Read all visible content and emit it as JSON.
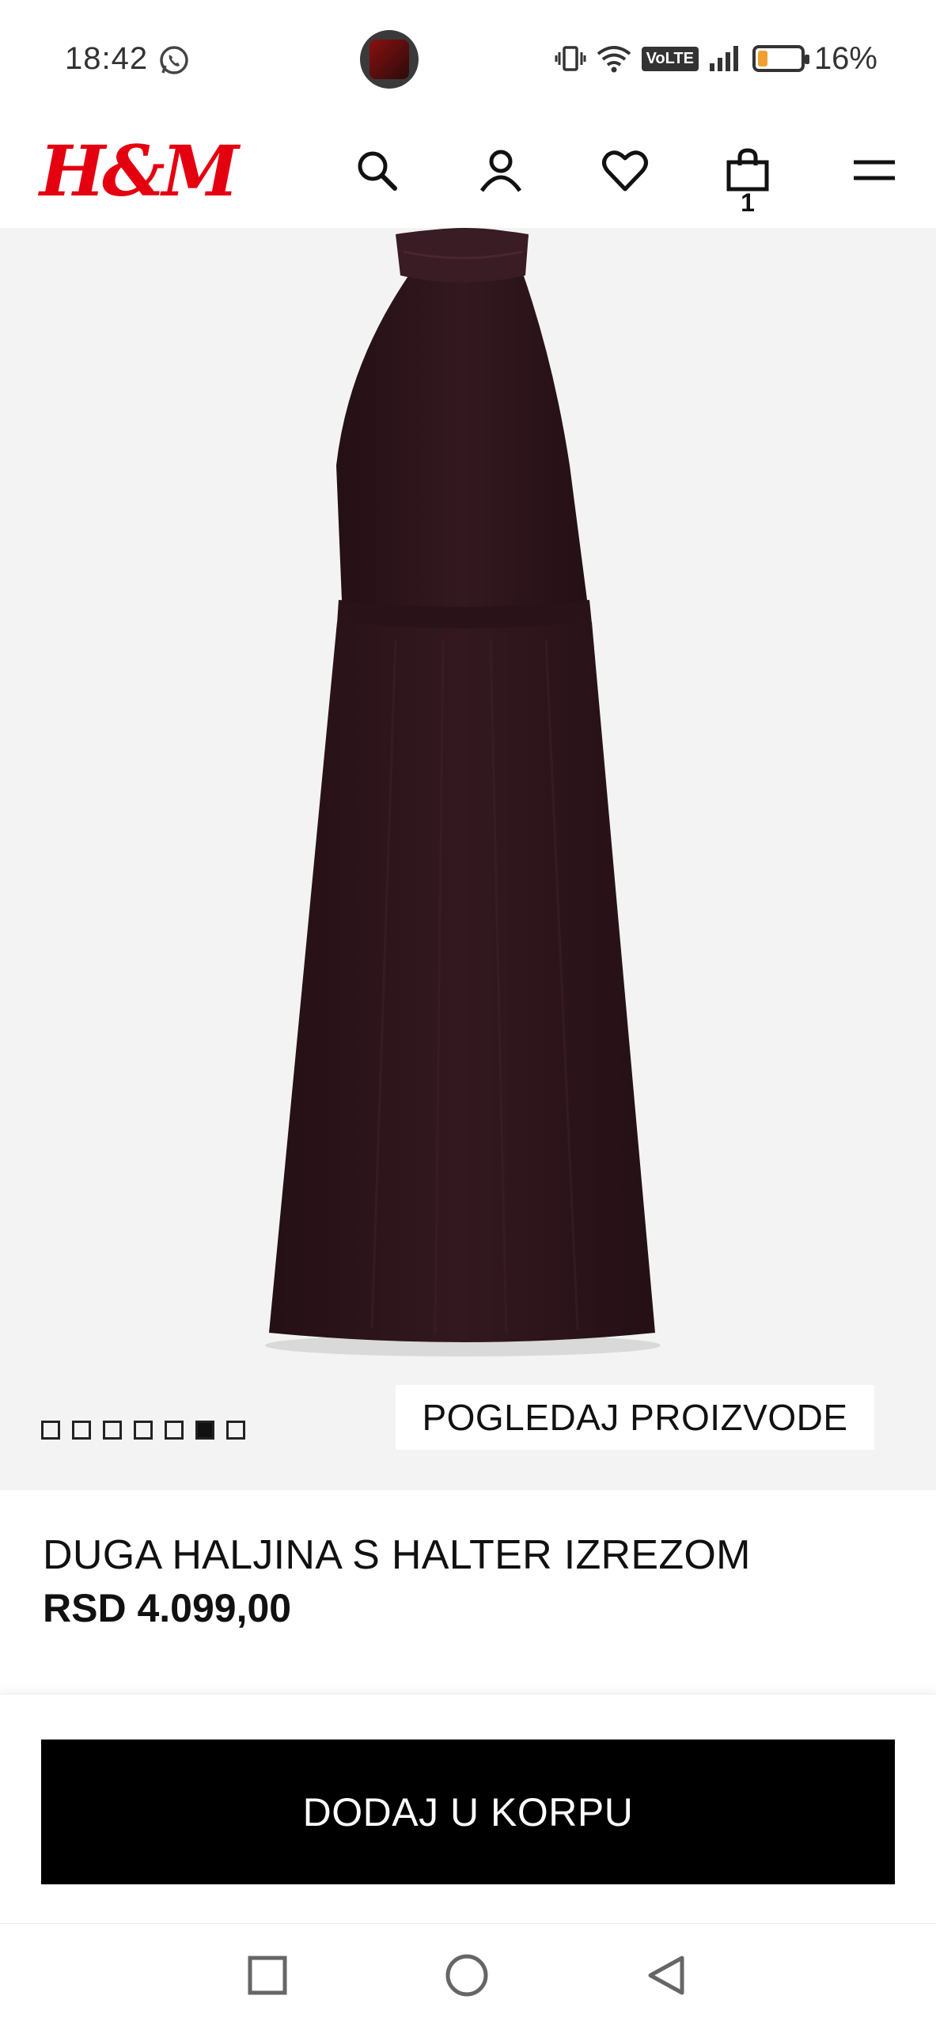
{
  "status_bar": {
    "time": "18:42",
    "battery_percent_text": "16%",
    "volte_label": "VoLTE",
    "icons": [
      "whatsapp-icon",
      "vibrate-icon",
      "wifi-icon",
      "volte-icon",
      "signal-icon",
      "battery-icon"
    ],
    "battery_level": 0.16
  },
  "header": {
    "logo_text": "H&M",
    "bag_count": "1",
    "icons": [
      "search-icon",
      "account-icon",
      "heart-icon",
      "bag-icon",
      "menu-icon"
    ],
    "brand_color": "#e50010"
  },
  "gallery": {
    "image_count": 7,
    "active_index": 5,
    "view_products_label": "POGLEDAJ PROIZVODE",
    "dress_color": "#2c151b"
  },
  "product": {
    "name": "DUGA HALJINA S HALTER IZREZOM",
    "price": "RSD 4.099,00"
  },
  "cta": {
    "add_to_cart_label": "DODAJ U KORPU"
  },
  "nav": {
    "buttons": [
      "recents-square-icon",
      "home-circle-icon",
      "back-triangle-icon"
    ]
  }
}
